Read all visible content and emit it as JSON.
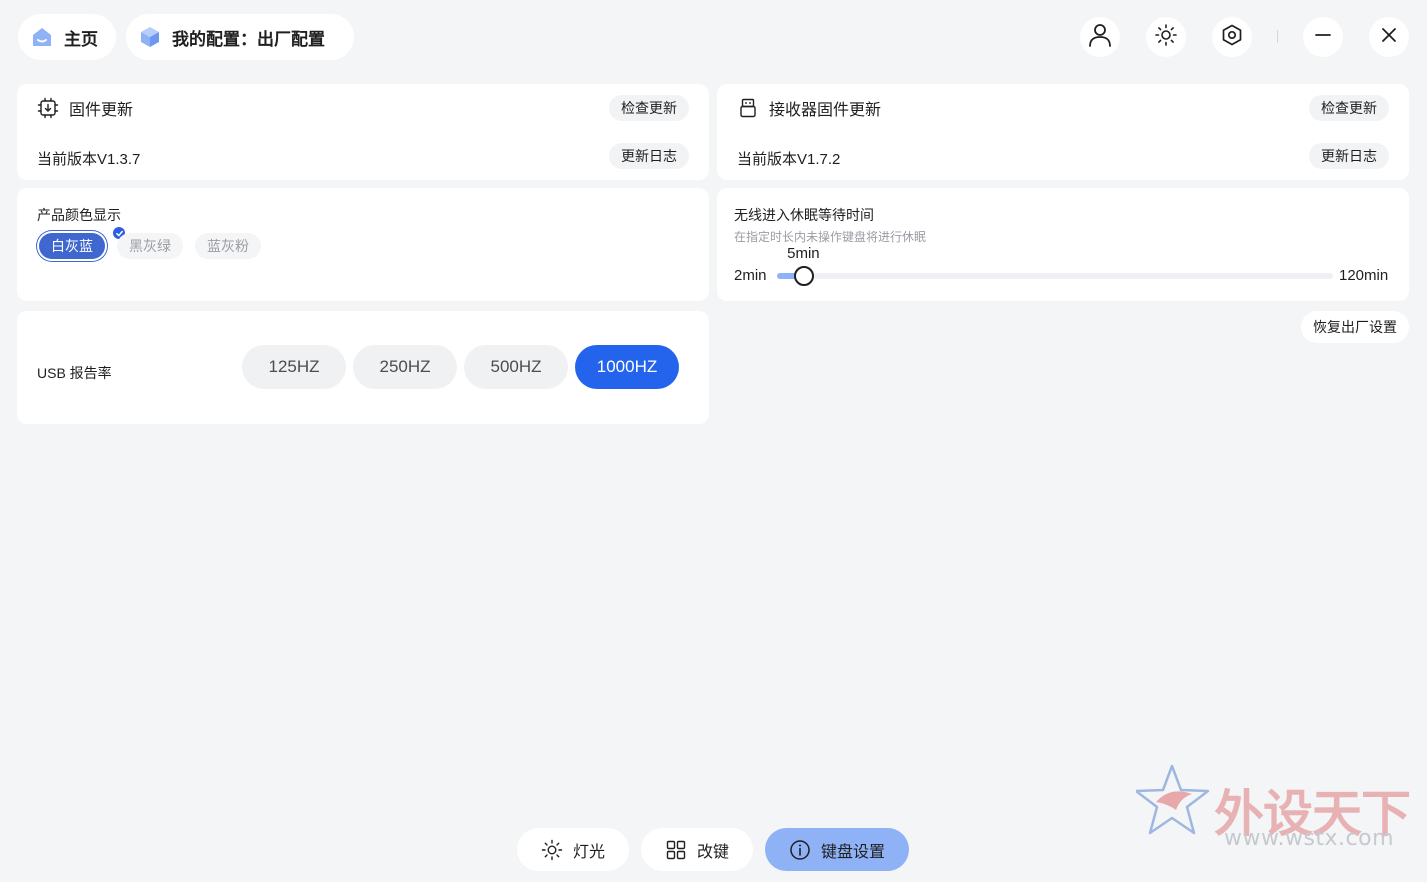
{
  "topbar": {
    "home_label": "主页",
    "config_label": "我的配置：出厂配置",
    "icons": [
      "user-icon",
      "brightness-icon",
      "settings-hex-icon",
      "minimize-icon",
      "close-icon"
    ]
  },
  "firmware": {
    "title": "固件更新",
    "check_label": "检查更新",
    "version": "当前版本V1.3.7",
    "log_label": "更新日志"
  },
  "receiver_firmware": {
    "title": "接收器固件更新",
    "check_label": "检查更新",
    "version": "当前版本V1.7.2",
    "log_label": "更新日志"
  },
  "product_color": {
    "title": "产品颜色显示",
    "options": [
      "白灰蓝",
      "黑灰绿",
      "蓝灰粉"
    ],
    "selected": "白灰蓝"
  },
  "sleep": {
    "title": "无线进入休眠等待时间",
    "subtitle": "在指定时长内未操作键盘将进行休眠",
    "value_label": "5min",
    "min_label": "2min",
    "max_label": "120min",
    "min": 2,
    "max": 120,
    "value": 5
  },
  "usb_rate": {
    "label": "USB 报告率",
    "options": [
      "125HZ",
      "250HZ",
      "500HZ",
      "1000HZ"
    ],
    "selected": "1000HZ"
  },
  "reset_label": "恢复出厂设置",
  "bottom_tabs": [
    {
      "label": "灯光",
      "icon": "light-icon"
    },
    {
      "label": "改键",
      "icon": "keymap-grid-icon"
    },
    {
      "label": "键盘设置",
      "icon": "info-icon"
    }
  ],
  "active_tab": "键盘设置",
  "watermark": {
    "title": "外设天下",
    "url": "www.wstx.com"
  },
  "colors": {
    "accent": "#2463eb",
    "accent_light": "#8fb2f7",
    "background": "#f4f5f7"
  }
}
